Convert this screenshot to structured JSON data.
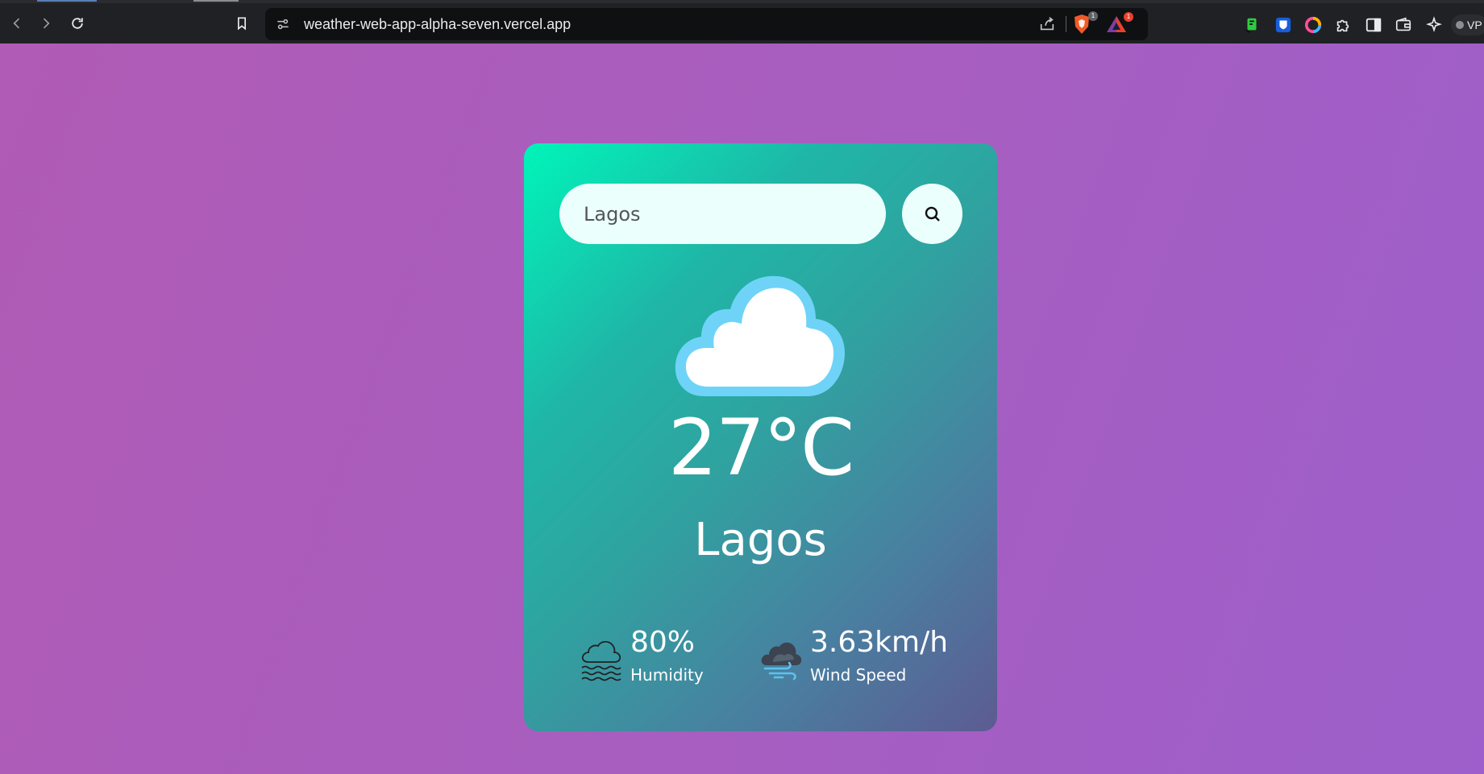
{
  "browser": {
    "url": "weather-web-app-alpha-seven.vercel.app",
    "shield_badge": "1",
    "rewards_badge": "1",
    "vpn_label": "VP"
  },
  "app": {
    "search": {
      "value": "Lagos",
      "placeholder": ""
    },
    "weather_icon": "cloud-icon",
    "temperature": "27°C",
    "city": "Lagos",
    "humidity": {
      "value": "80%",
      "label": "Humidity",
      "icon": "humidity-icon"
    },
    "wind": {
      "value": "3.63km/h",
      "label": "Wind Speed",
      "icon": "wind-icon"
    }
  },
  "colors": {
    "card_gradient_start": "#00f5b9",
    "card_gradient_end": "#5d5b92",
    "page_background": "#a75ec0",
    "cloud_fill": "#ffffff",
    "cloud_outline": "#6fd3f7"
  }
}
